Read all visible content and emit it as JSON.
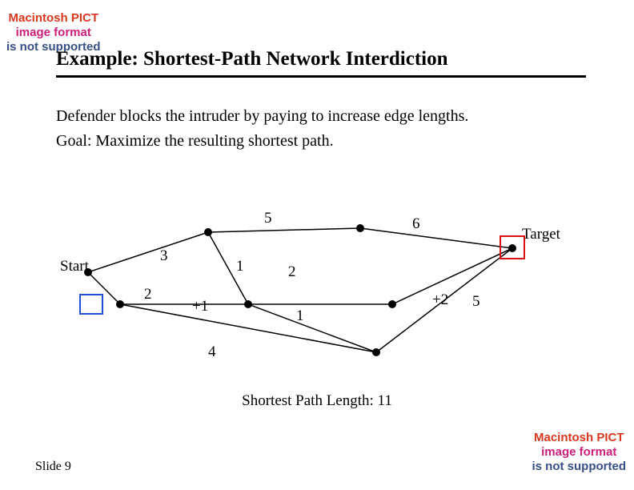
{
  "error_box": {
    "l1": "Macintosh PICT",
    "l2": "image format",
    "l3": "is not supported"
  },
  "title": "Example: Shortest-Path Network Interdiction",
  "body": {
    "p1": "Defender blocks the intruder by paying to increase edge lengths.",
    "p2": "Goal: Maximize the resulting shortest path."
  },
  "diagram": {
    "start_label": "Start",
    "target_label": "Target",
    "weights": {
      "w5": "5",
      "w6": "6",
      "w3": "3",
      "w1a": "1",
      "w2a": "2",
      "w2b": "2",
      "plus1": "+1",
      "w1b": "1",
      "plus2": "+2",
      "w5b": "5",
      "w4": "4"
    }
  },
  "result": "Shortest Path Length: 11",
  "slide": "Slide 9",
  "chart_data": {
    "type": "diagram",
    "description": "Network graph with Start and Target nodes; edges weighted; two interdictions (+1, +2) applied.",
    "nodes": [
      "Start",
      "A",
      "B",
      "C",
      "D",
      "E",
      "F",
      "Target"
    ],
    "edges": [
      {
        "from": "Start",
        "to": "A",
        "weight": 3
      },
      {
        "from": "Start",
        "to": "B",
        "weight": 2,
        "interdiction_box": "blue"
      },
      {
        "from": "A",
        "to": "C",
        "weight": 5
      },
      {
        "from": "A",
        "to": "D",
        "weight": 1
      },
      {
        "from": "B",
        "to": "D",
        "weight": "+1"
      },
      {
        "from": "D",
        "to": "E",
        "weight": 2
      },
      {
        "from": "D",
        "to": "F",
        "weight": 1
      },
      {
        "from": "B",
        "to": "F",
        "weight": 4
      },
      {
        "from": "C",
        "to": "Target",
        "weight": 6
      },
      {
        "from": "E",
        "to": "Target",
        "weight": "+2",
        "interdiction_box": "red"
      },
      {
        "from": "F",
        "to": "Target",
        "weight": 5
      }
    ],
    "shortest_path_length": 11
  }
}
